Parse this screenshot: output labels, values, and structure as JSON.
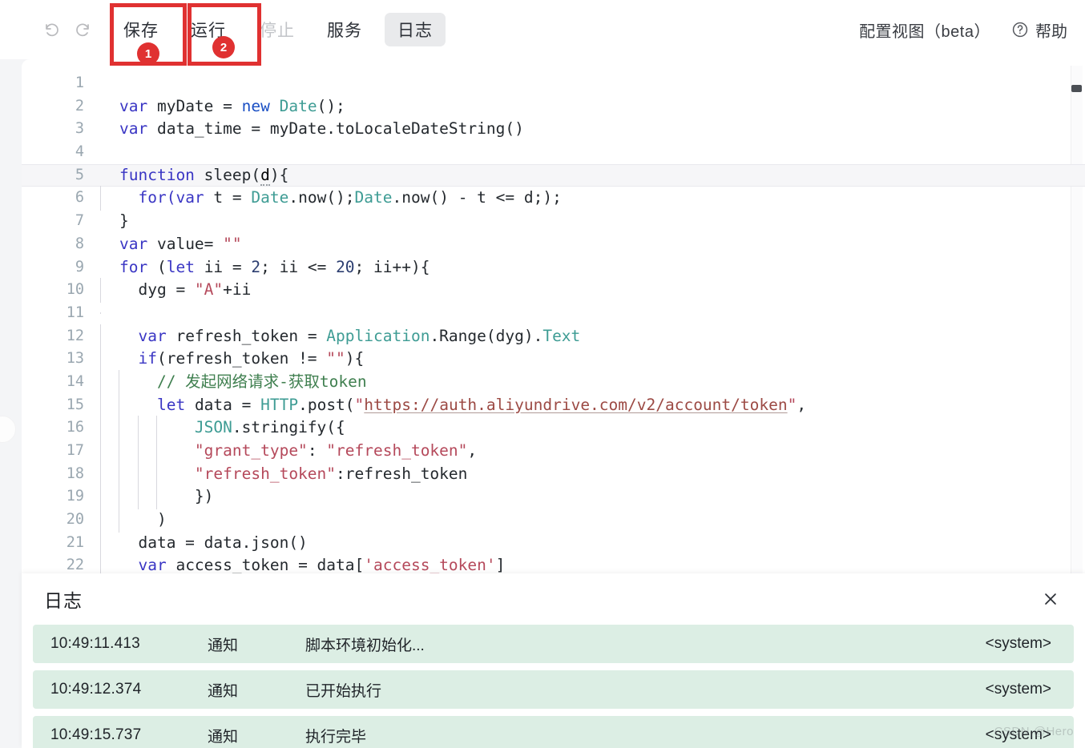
{
  "toolbar": {
    "undo_label": "undo-arrow",
    "redo_label": "redo-arrow",
    "save_label": "保存",
    "run_label": "运行",
    "stop_label": "停止",
    "service_label": "服务",
    "log_label": "日志",
    "config_view_label": "配置视图（beta）",
    "help_label": "帮助",
    "annotations": [
      {
        "number": "1",
        "target": "保存"
      },
      {
        "number": "2",
        "target": "运行"
      }
    ]
  },
  "editor": {
    "lines": [
      {
        "n": "1",
        "segs": []
      },
      {
        "n": "2",
        "segs": [
          {
            "t": "var ",
            "c": "kw"
          },
          {
            "t": "myDate = ",
            "c": "pln"
          },
          {
            "t": "new ",
            "c": "kw2"
          },
          {
            "t": "Date",
            "c": "typ"
          },
          {
            "t": "();",
            "c": "pln"
          }
        ]
      },
      {
        "n": "3",
        "segs": [
          {
            "t": "var ",
            "c": "kw"
          },
          {
            "t": "data_time = myDate.toLocaleDateString()",
            "c": "pln"
          }
        ]
      },
      {
        "n": "4",
        "segs": []
      },
      {
        "n": "5",
        "hl": true,
        "segs": [
          {
            "t": "function ",
            "c": "kw"
          },
          {
            "t": "sleep(",
            "c": "pln"
          },
          {
            "t": "d",
            "c": "dot"
          },
          {
            "t": "){",
            "c": "pln"
          }
        ]
      },
      {
        "n": "6",
        "guides": [
          0
        ],
        "segs": [
          {
            "t": "  for(",
            "c": "kw"
          },
          {
            "t": "var ",
            "c": "kw"
          },
          {
            "t": "t = ",
            "c": "pln"
          },
          {
            "t": "Date",
            "c": "typ"
          },
          {
            "t": ".now();",
            "c": "pln"
          },
          {
            "t": "Date",
            "c": "typ"
          },
          {
            "t": ".now() - t <= d;);",
            "c": "pln"
          }
        ]
      },
      {
        "n": "7",
        "segs": [
          {
            "t": "}",
            "c": "pln"
          }
        ]
      },
      {
        "n": "8",
        "segs": [
          {
            "t": "var ",
            "c": "kw"
          },
          {
            "t": "value= ",
            "c": "pln"
          },
          {
            "t": "\"\"",
            "c": "str"
          }
        ]
      },
      {
        "n": "9",
        "segs": [
          {
            "t": "for ",
            "c": "kw"
          },
          {
            "t": "(",
            "c": "pln"
          },
          {
            "t": "let ",
            "c": "kw"
          },
          {
            "t": "ii = ",
            "c": "pln"
          },
          {
            "t": "2",
            "c": "num"
          },
          {
            "t": "; ii <= ",
            "c": "pln"
          },
          {
            "t": "20",
            "c": "num"
          },
          {
            "t": "; ii++){",
            "c": "pln"
          }
        ]
      },
      {
        "n": "10",
        "guides": [
          0
        ],
        "segs": [
          {
            "t": "  dyg = ",
            "c": "pln"
          },
          {
            "t": "\"A\"",
            "c": "str"
          },
          {
            "t": "+ii",
            "c": "pln"
          }
        ]
      },
      {
        "n": "11",
        "guides": [
          0
        ],
        "segs": []
      },
      {
        "n": "12",
        "guides": [
          0
        ],
        "segs": [
          {
            "t": "  ",
            "c": "pln"
          },
          {
            "t": "var ",
            "c": "kw"
          },
          {
            "t": "refresh_token = ",
            "c": "pln"
          },
          {
            "t": "Application",
            "c": "typ"
          },
          {
            "t": ".Range(dyg).",
            "c": "pln"
          },
          {
            "t": "Text",
            "c": "typ"
          }
        ]
      },
      {
        "n": "13",
        "guides": [
          0
        ],
        "segs": [
          {
            "t": "  ",
            "c": "pln"
          },
          {
            "t": "if",
            "c": "kw"
          },
          {
            "t": "(refresh_token != ",
            "c": "pln"
          },
          {
            "t": "\"\"",
            "c": "str"
          },
          {
            "t": "){",
            "c": "pln"
          }
        ]
      },
      {
        "n": "14",
        "guides": [
          0,
          1
        ],
        "segs": [
          {
            "t": "    // 发起网络请求-获取token",
            "c": "cmt"
          }
        ]
      },
      {
        "n": "15",
        "guides": [
          0,
          1
        ],
        "segs": [
          {
            "t": "    ",
            "c": "pln"
          },
          {
            "t": "let ",
            "c": "kw"
          },
          {
            "t": "data = ",
            "c": "pln"
          },
          {
            "t": "HTTP",
            "c": "typ"
          },
          {
            "t": ".post(",
            "c": "pln"
          },
          {
            "t": "\"",
            "c": "str"
          },
          {
            "t": "https://auth.aliyundrive.com/v2/account/token",
            "c": "strU"
          },
          {
            "t": "\"",
            "c": "str"
          },
          {
            "t": ",",
            "c": "pln"
          }
        ]
      },
      {
        "n": "16",
        "guides": [
          0,
          1,
          2,
          3
        ],
        "segs": [
          {
            "t": "        ",
            "c": "pln"
          },
          {
            "t": "JSON",
            "c": "typ"
          },
          {
            "t": ".stringify({",
            "c": "pln"
          }
        ]
      },
      {
        "n": "17",
        "guides": [
          0,
          1,
          2,
          3
        ],
        "segs": [
          {
            "t": "        ",
            "c": "pln"
          },
          {
            "t": "\"grant_type\"",
            "c": "str"
          },
          {
            "t": ": ",
            "c": "pln"
          },
          {
            "t": "\"refresh_token\"",
            "c": "str"
          },
          {
            "t": ",",
            "c": "pln"
          }
        ]
      },
      {
        "n": "18",
        "guides": [
          0,
          1,
          2,
          3
        ],
        "segs": [
          {
            "t": "        ",
            "c": "pln"
          },
          {
            "t": "\"refresh_token\"",
            "c": "str"
          },
          {
            "t": ":refresh_token",
            "c": "pln"
          }
        ]
      },
      {
        "n": "19",
        "guides": [
          0,
          1,
          2,
          3
        ],
        "segs": [
          {
            "t": "        })",
            "c": "pln"
          }
        ]
      },
      {
        "n": "20",
        "guides": [
          0,
          1
        ],
        "segs": [
          {
            "t": "    )",
            "c": "pln"
          }
        ]
      },
      {
        "n": "21",
        "guides": [
          0
        ],
        "segs": [
          {
            "t": "  data = data.json()",
            "c": "pln"
          }
        ]
      },
      {
        "n": "22",
        "guides": [
          0
        ],
        "segs": [
          {
            "t": "  ",
            "c": "pln"
          },
          {
            "t": "var ",
            "c": "kw"
          },
          {
            "t": "access_token = data[",
            "c": "pln"
          },
          {
            "t": "'access_token'",
            "c": "str"
          },
          {
            "t": "]",
            "c": "pln"
          }
        ]
      }
    ]
  },
  "log": {
    "title": "日志",
    "close_label": "✕",
    "rows": [
      {
        "time": "10:49:11.413",
        "level": "通知",
        "message": "脚本环境初始化...",
        "source": "<system>"
      },
      {
        "time": "10:49:12.374",
        "level": "通知",
        "message": "已开始执行",
        "source": "<system>"
      },
      {
        "time": "10:49:15.737",
        "level": "通知",
        "message": "执行完毕",
        "source": "<system>"
      }
    ]
  },
  "watermark": "CSDN @Hero",
  "colors": {
    "annotation_red": "#e03131",
    "log_row_bg": "#dceee4",
    "active_tab_bg": "#e9eaec"
  }
}
